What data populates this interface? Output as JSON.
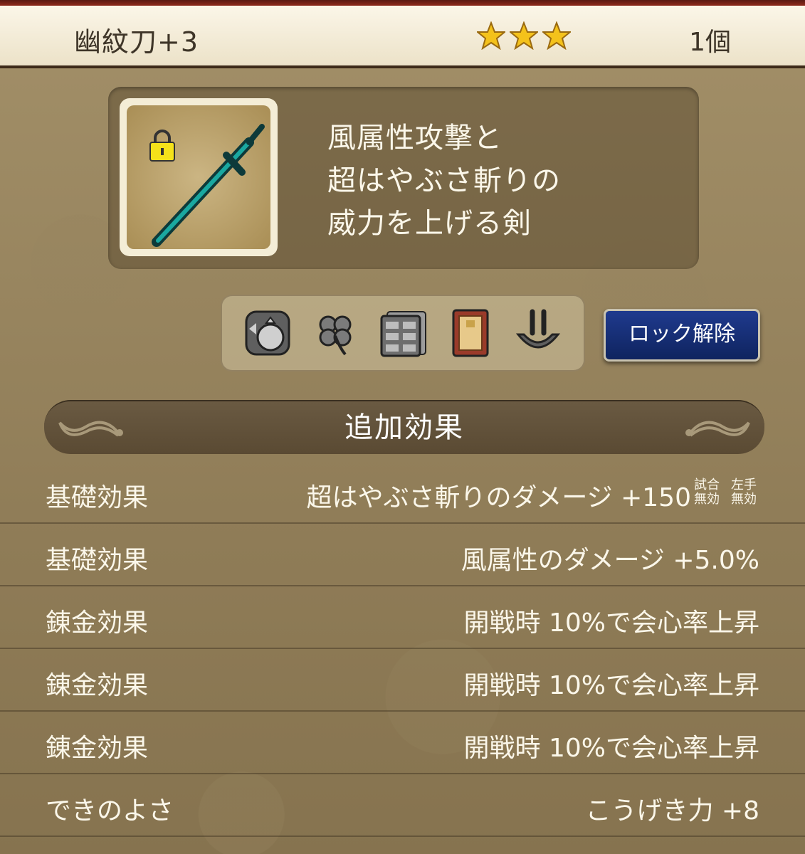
{
  "header": {
    "item_name": "幽紋刀+3",
    "stars": 3,
    "count": "1個"
  },
  "item": {
    "description": "風属性攻撃と\n超はやぶさ斬りの\n威力を上げる剣",
    "locked": true,
    "icon": "sword-icon"
  },
  "tray_icons": [
    "recycle-bag-icon",
    "clover-icon",
    "storage-drawer-icon",
    "book-icon",
    "tongs-icon"
  ],
  "unlock_button": {
    "label": "ロック解除"
  },
  "section": {
    "title": "追加効果"
  },
  "effects": [
    {
      "label": "基礎効果",
      "value": "超はやぶさ斬りのダメージ +150",
      "notes": [
        "試合\n無効",
        "左手\n無効"
      ]
    },
    {
      "label": "基礎効果",
      "value": "風属性のダメージ +5.0%"
    },
    {
      "label": "錬金効果",
      "value": "開戦時 10%で会心率上昇"
    },
    {
      "label": "錬金効果",
      "value": "開戦時 10%で会心率上昇"
    },
    {
      "label": "錬金効果",
      "value": "開戦時 10%で会心率上昇"
    },
    {
      "label": "できのよさ",
      "value": "こうげき力 +8"
    }
  ],
  "colors": {
    "star": "#f4c21b",
    "button": "#1f3a8e",
    "text_light": "#fbf7ea"
  }
}
